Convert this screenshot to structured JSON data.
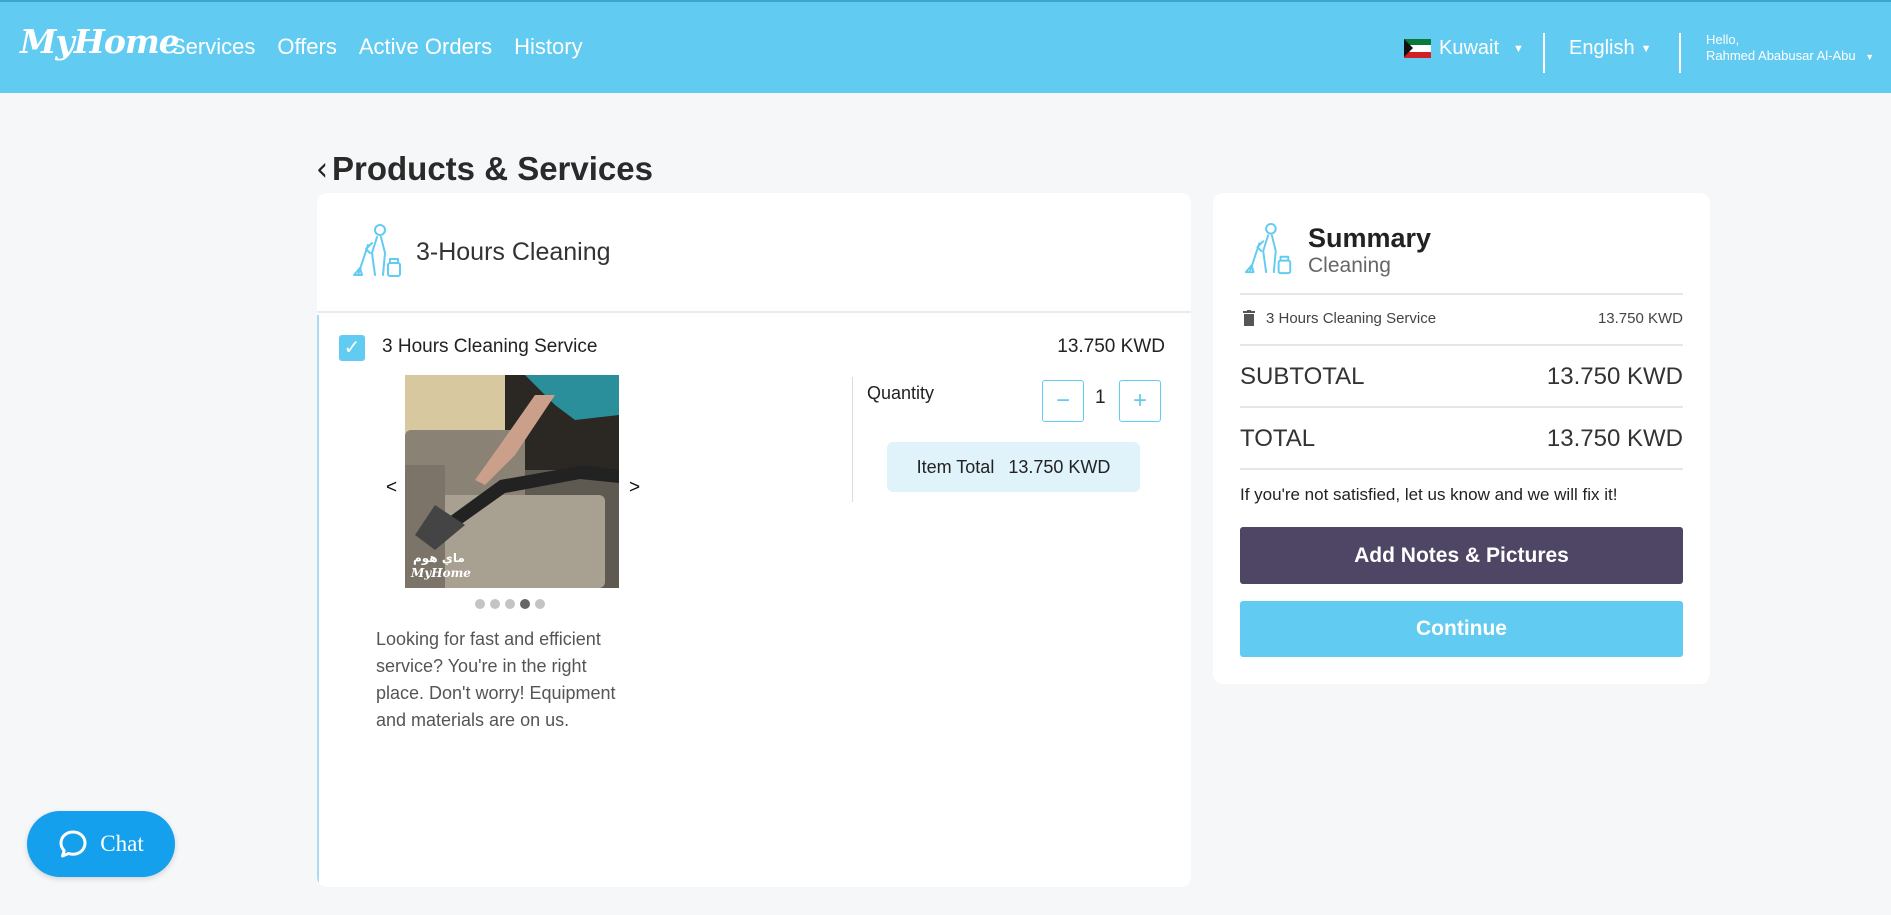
{
  "app": {
    "logo": "MyHome",
    "brand_color": "#62cbf1"
  },
  "nav": {
    "links": [
      "Services",
      "Offers",
      "Active Orders",
      "History"
    ],
    "country": "Kuwait",
    "language": "English",
    "greeting": "Hello,",
    "user_name": "Rahmed Ababusar Al-Abu"
  },
  "page": {
    "title": "Products & Services"
  },
  "product": {
    "card_title": "3-Hours Cleaning",
    "item_name": "3 Hours Cleaning Service",
    "item_price": "13.750 KWD",
    "checked": true,
    "carousel_prev": "<",
    "carousel_next": ">",
    "carousel_count": 5,
    "carousel_active_index": 3,
    "photo_watermark_ar": "ماي هوم",
    "photo_watermark_en": "MyHome",
    "description": "Looking for fast and efficient service? You're in the right place. Don't worry! Equipment and materials are on us.",
    "quantity_label": "Quantity",
    "quantity": "1",
    "minus_label": "−",
    "plus_label": "+",
    "item_total_label": "Item Total",
    "item_total_value": "13.750 KWD"
  },
  "summary": {
    "title": "Summary",
    "subtitle": "Cleaning",
    "line_item_name": "3 Hours Cleaning Service",
    "line_item_price": "13.750 KWD",
    "subtotal_label": "SUBTOTAL",
    "subtotal_value": "13.750 KWD",
    "total_label": "TOTAL",
    "total_value": "13.750 KWD",
    "guarantee": "If you're not satisfied, let us know and we will fix it!",
    "notes_button": "Add Notes & Pictures",
    "continue_button": "Continue"
  },
  "chat": {
    "label": "Chat"
  }
}
